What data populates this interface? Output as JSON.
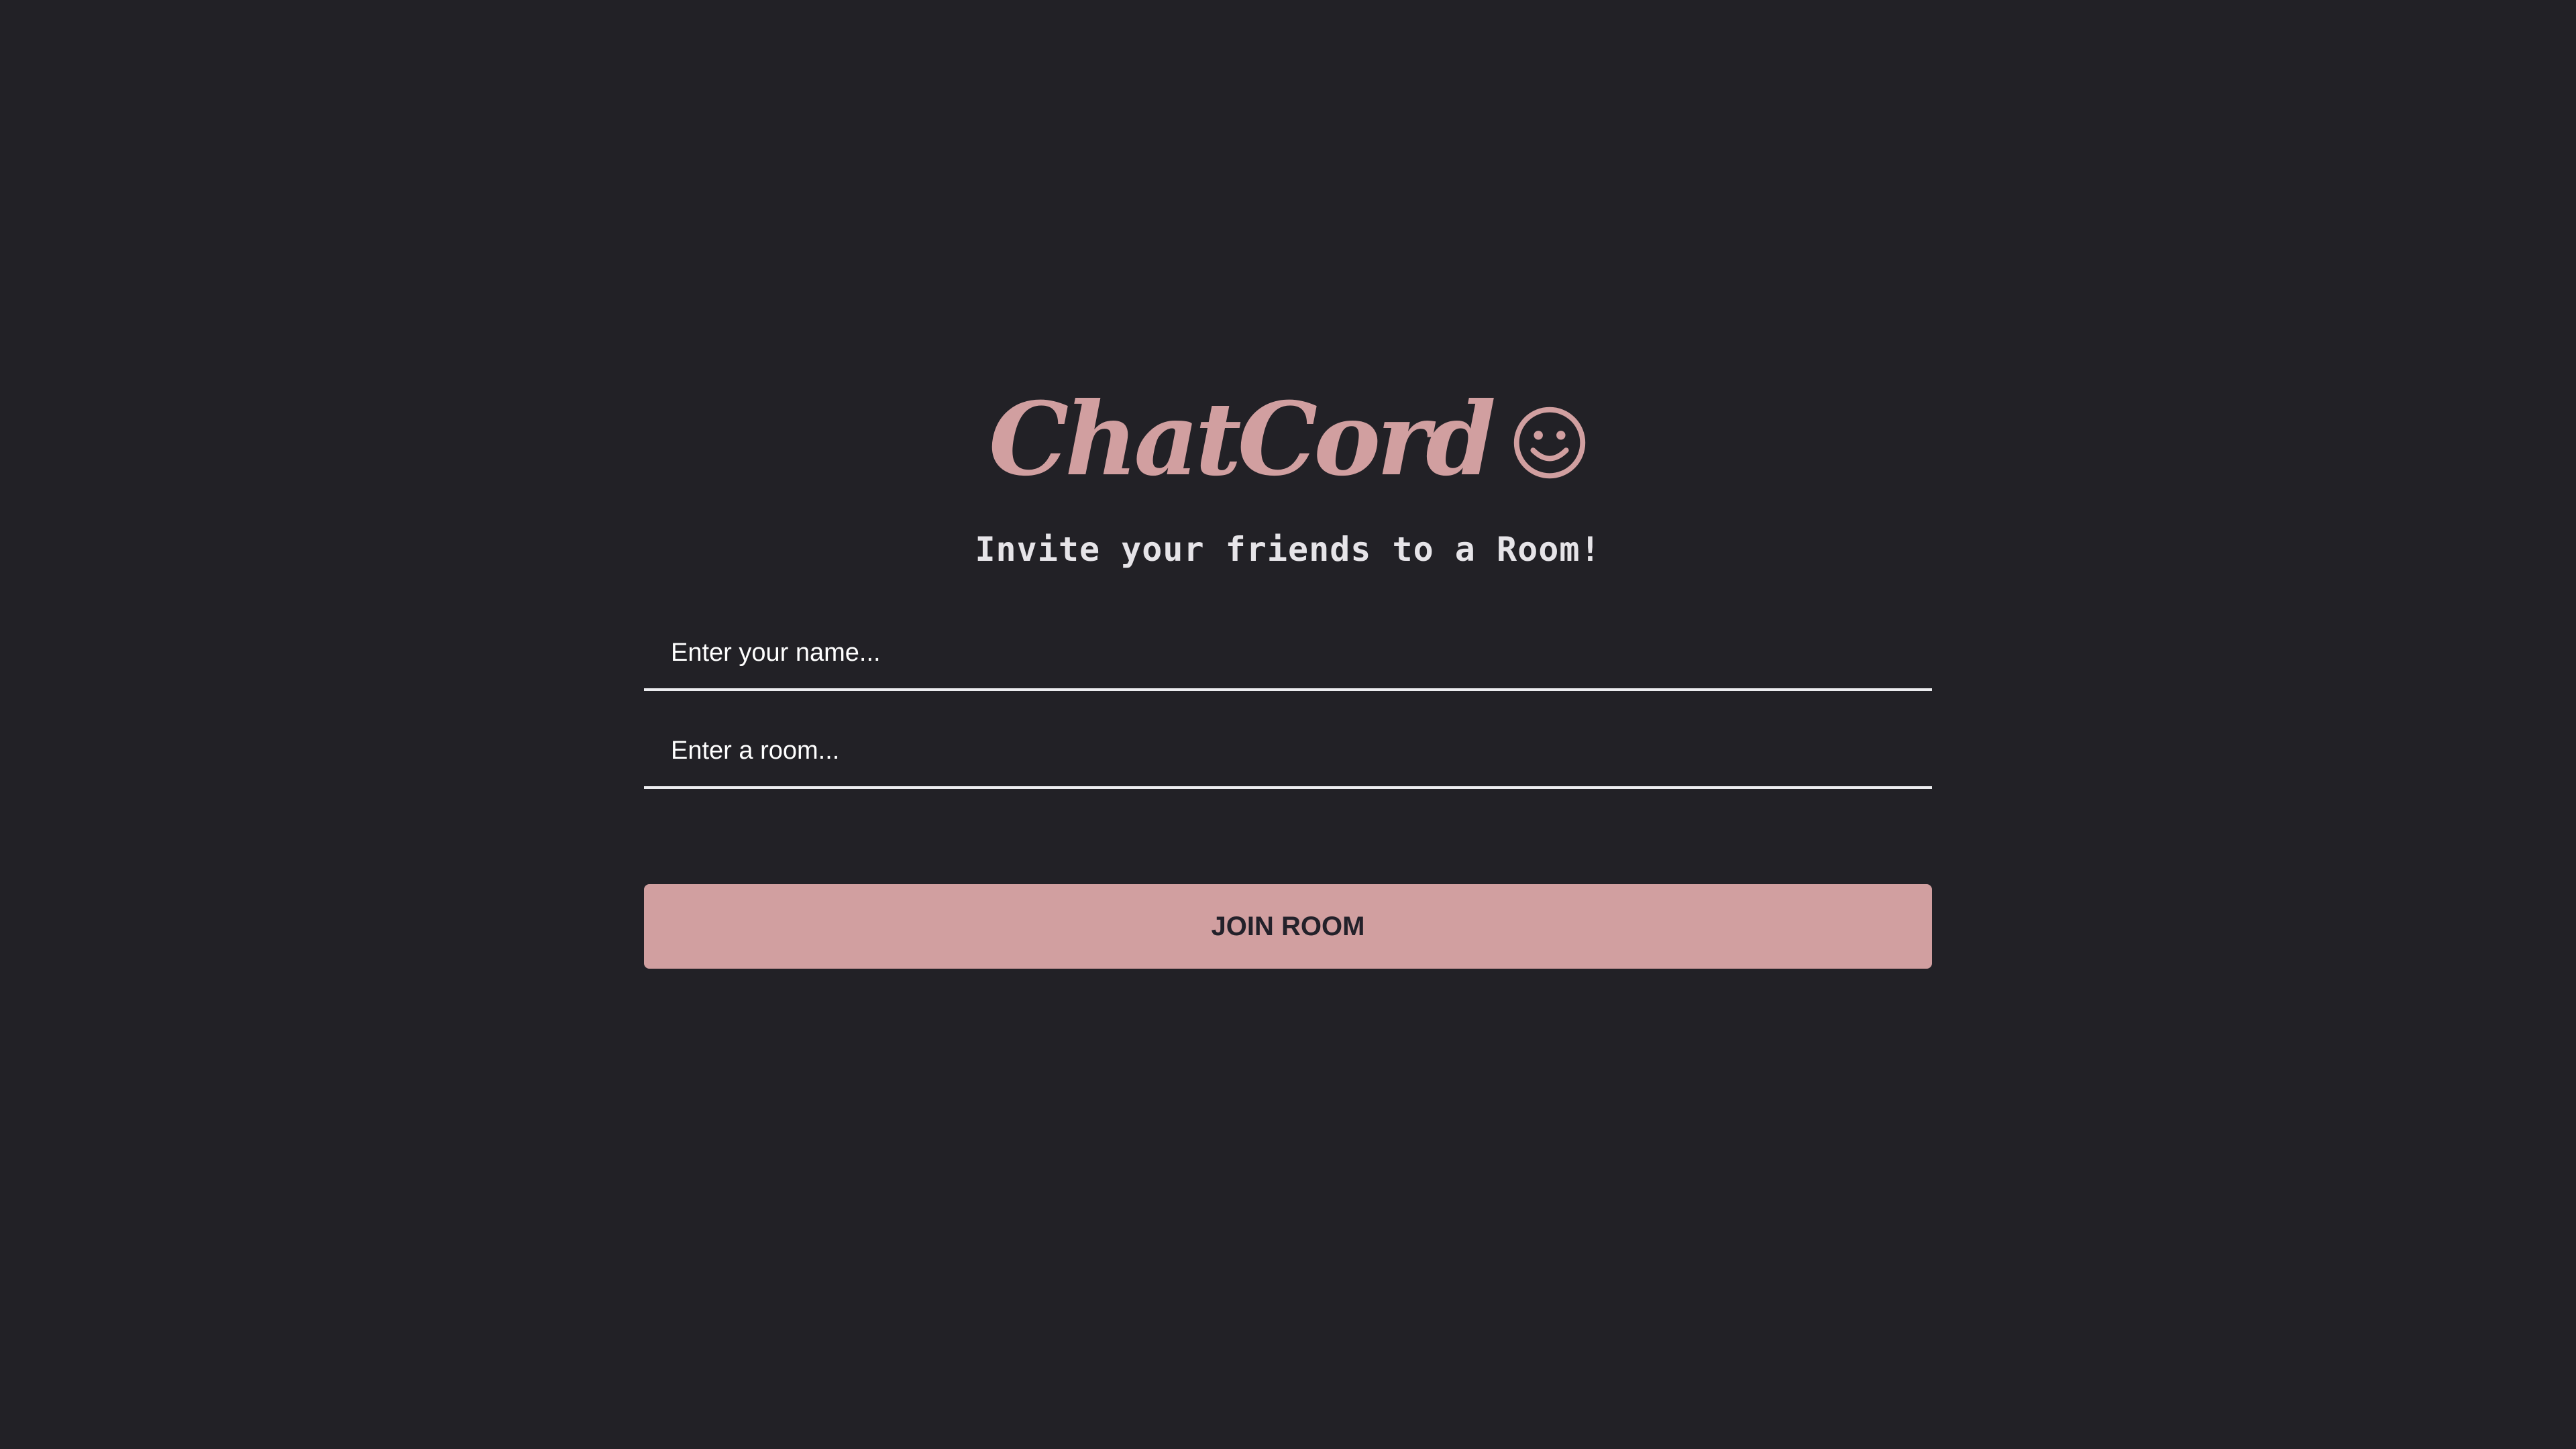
{
  "app": {
    "title": "ChatCord",
    "subtitle": "Invite your friends to a Room!"
  },
  "form": {
    "name_field": {
      "value": "",
      "placeholder": "Enter your name..."
    },
    "room_field": {
      "value": "",
      "placeholder": "Enter a room..."
    },
    "join_label": "JOIN ROOM"
  },
  "icons": {
    "title_icon": "smiley-icon"
  },
  "colors": {
    "background": "#222126",
    "accent": "#d19fa0",
    "text": "#e6e4e8",
    "button_text": "#23212a"
  }
}
